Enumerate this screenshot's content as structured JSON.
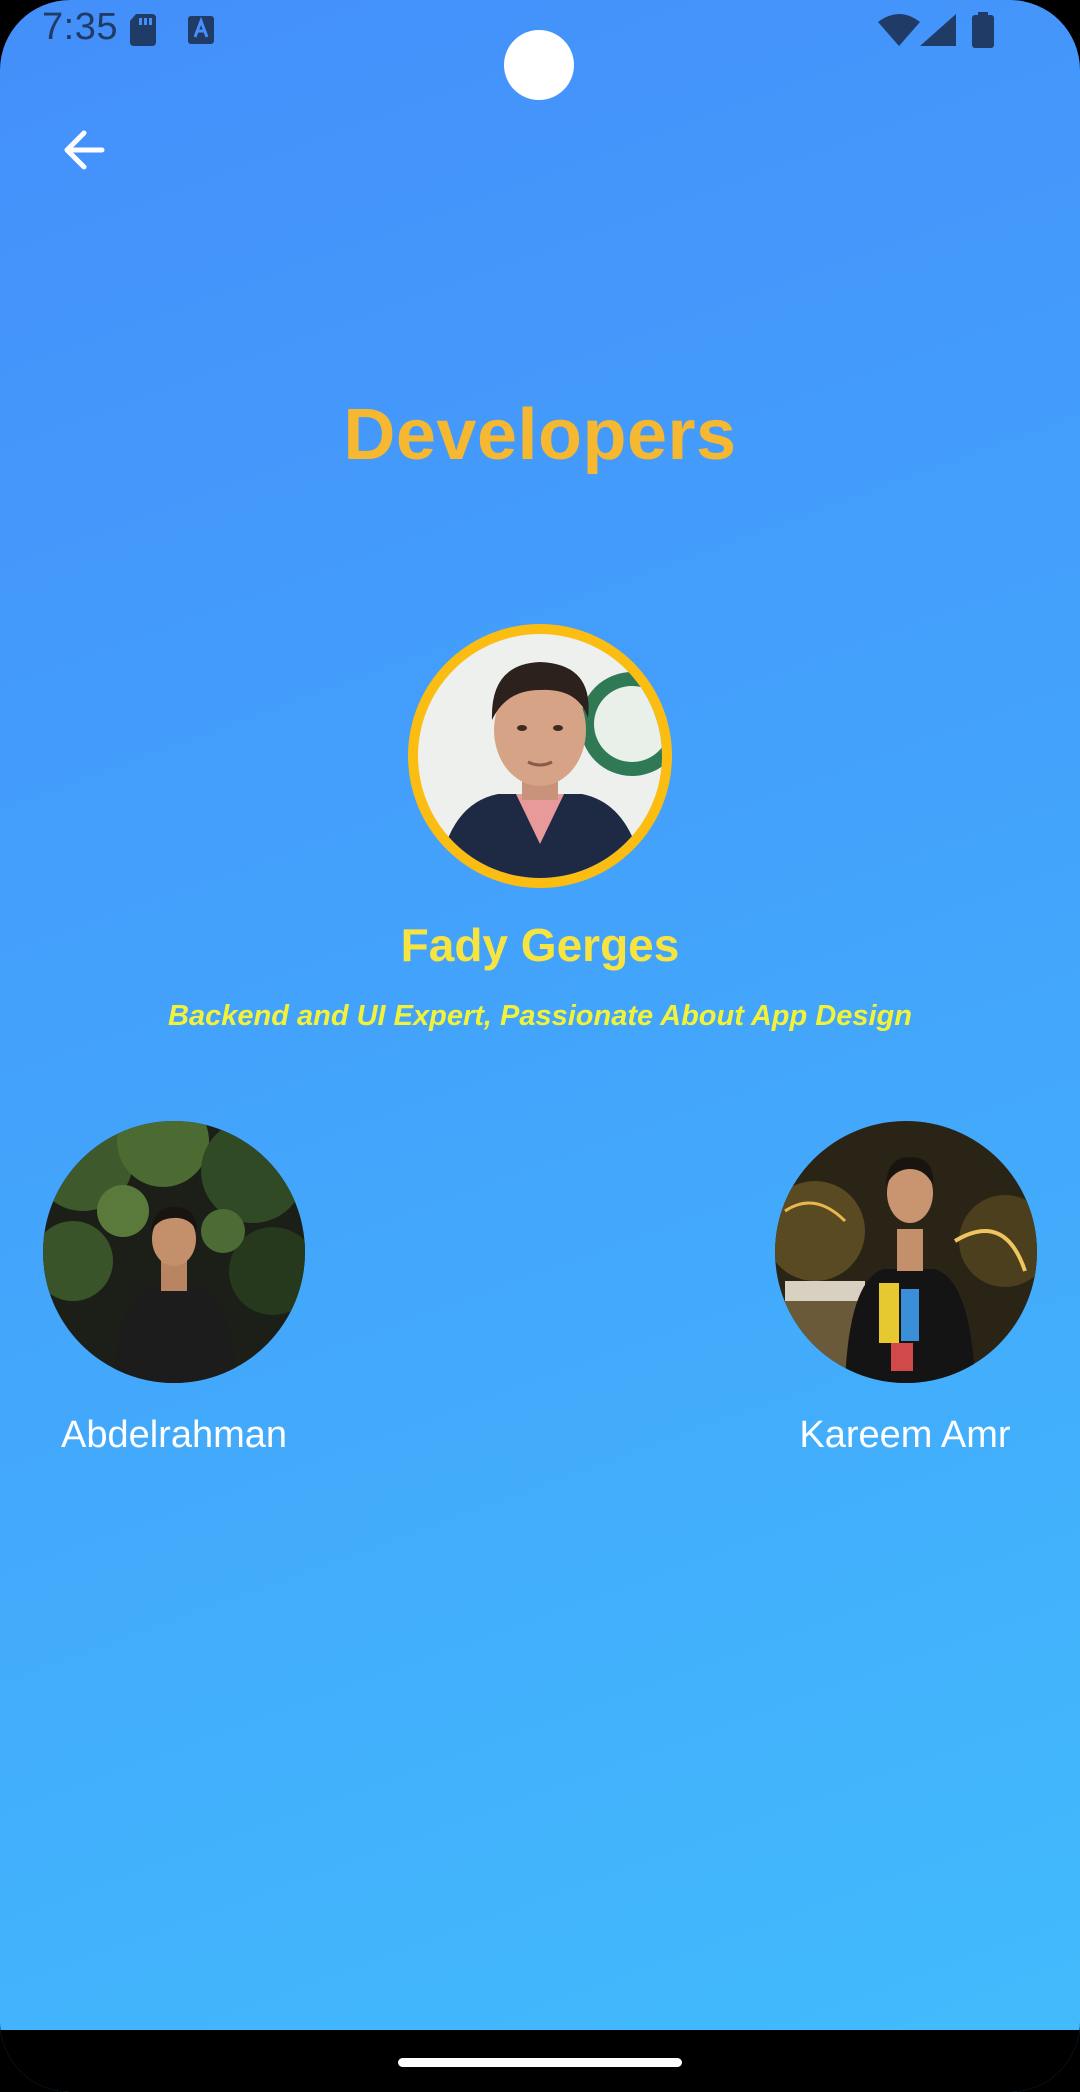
{
  "status_bar": {
    "time": "7:35",
    "icons": [
      "sd-card-icon",
      "text-a-icon",
      "wifi-icon",
      "cell-signal-icon",
      "battery-icon"
    ]
  },
  "header": {
    "back_icon": "arrow-left-icon"
  },
  "page": {
    "title": "Developers"
  },
  "lead_developer": {
    "name": "Fady Gerges",
    "role": "Backend and UI Expert, Passionate About App Design"
  },
  "developers": [
    {
      "name": "Abdelrahman"
    },
    {
      "name": "Kareem Amr"
    }
  ],
  "colors": {
    "background_top": "#448ffb",
    "background_bottom": "#42bcfc",
    "title": "#f5b830",
    "lead_ring": "#fbbd12",
    "lead_name": "#f7e440",
    "lead_role": "#f2f23a",
    "status_text": "#1f3b66"
  }
}
